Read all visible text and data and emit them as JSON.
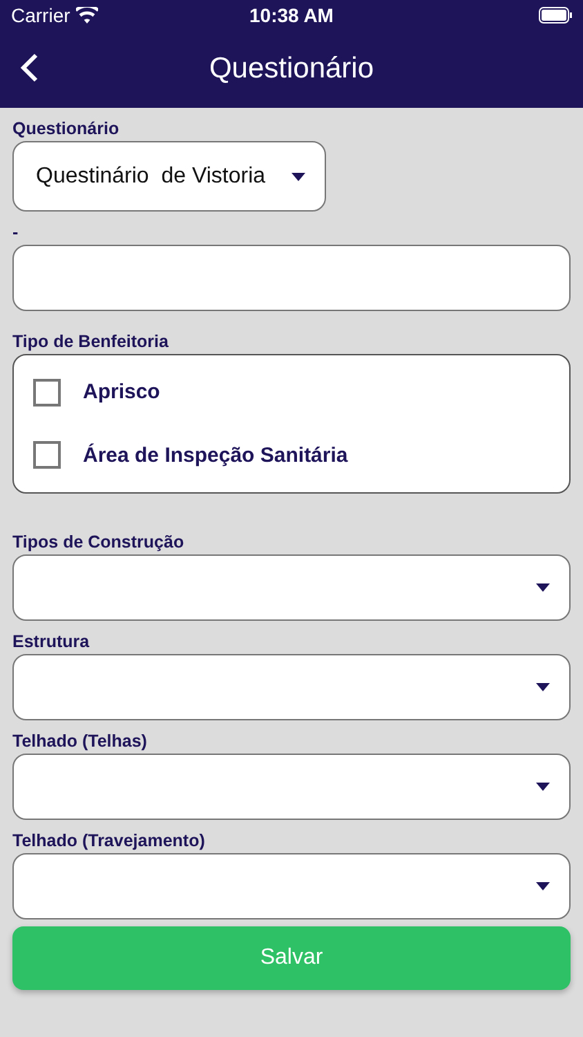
{
  "status_bar": {
    "carrier": "Carrier",
    "time": "10:38 AM"
  },
  "nav": {
    "title": "Questionário"
  },
  "questionnaire": {
    "label": "Questionário",
    "value": "Questinário  de Vistoria"
  },
  "text_field": {
    "label": "-"
  },
  "benfeitoria": {
    "label": "Tipo de Benfeitoria",
    "options": [
      {
        "label": "Aprisco",
        "checked": false
      },
      {
        "label": "Área de Inspeção Sanitária",
        "checked": false
      }
    ]
  },
  "selects": [
    {
      "label": "Tipos de Construção"
    },
    {
      "label": "Estrutura"
    },
    {
      "label": "Telhado (Telhas)"
    },
    {
      "label": "Telhado (Travejamento)"
    }
  ],
  "save_button": "Salvar"
}
